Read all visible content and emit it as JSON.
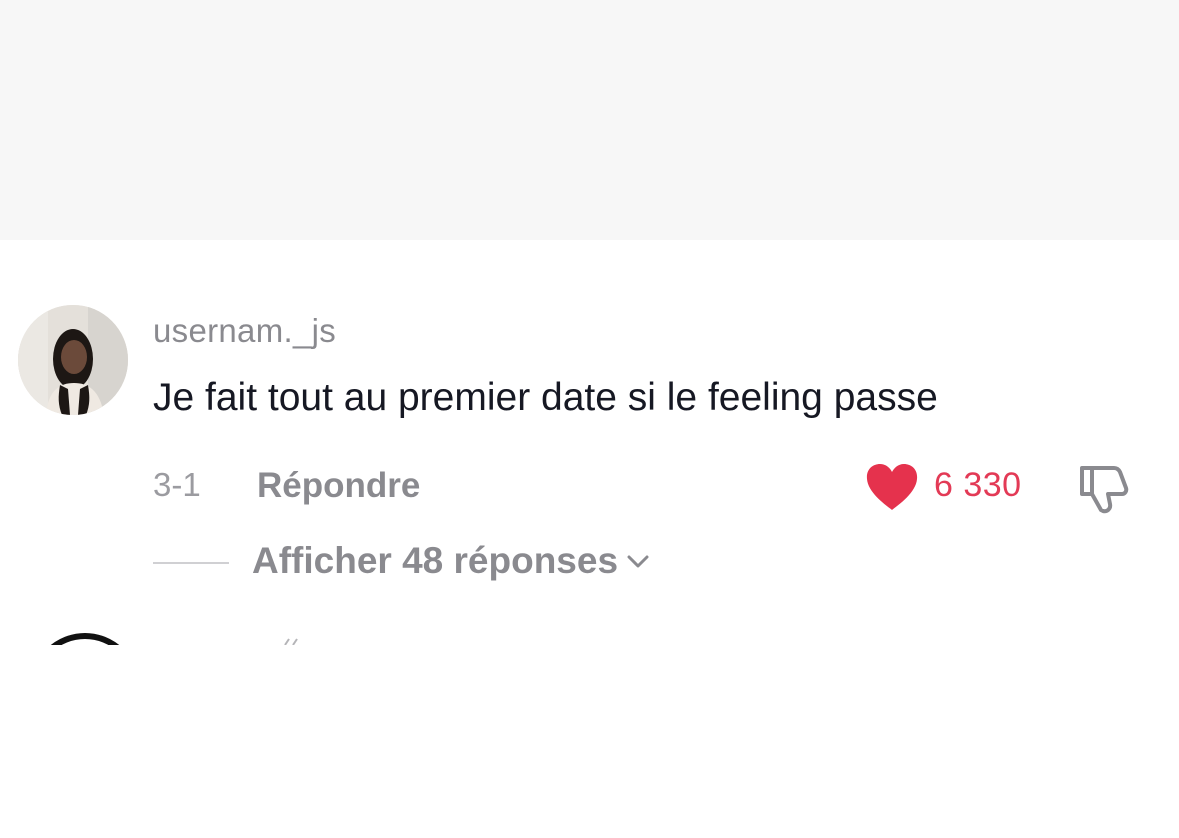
{
  "comment": {
    "username": "usernam._js",
    "text": "Je fait tout au premier date si le feeling passe",
    "date": "3-1",
    "reply_label": "Répondre",
    "like_count": "6 330",
    "liked": true,
    "view_replies_label": "Afficher 48 réponses"
  },
  "icons": {
    "avatar": "avatar",
    "like": "heart-icon",
    "dislike": "thumbs-down-icon",
    "expand": "chevron-down-icon"
  },
  "colors": {
    "like_active": "#fe2c55",
    "like_count": "#e33a56",
    "muted_text": "#8a8a8f",
    "primary_text": "#161823"
  }
}
